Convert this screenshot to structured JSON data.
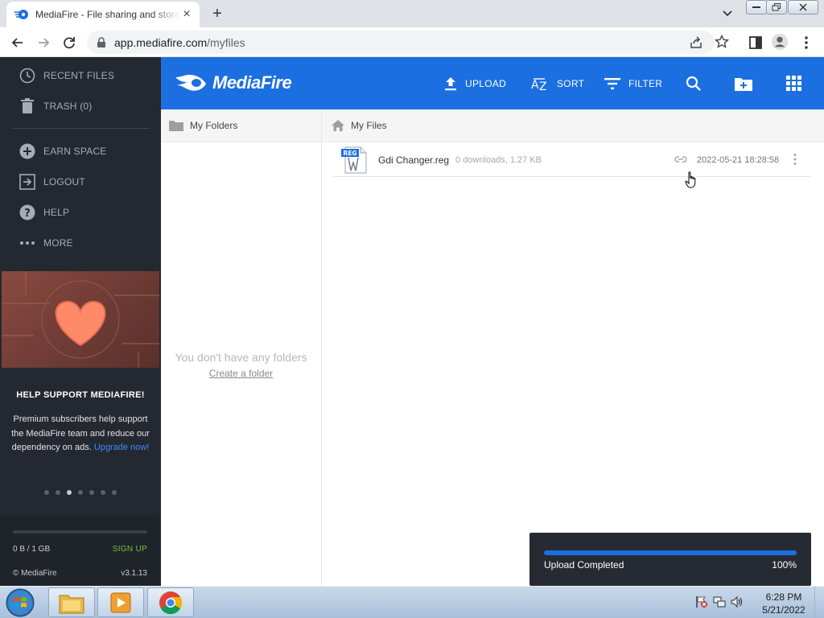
{
  "browser": {
    "tab_title": "MediaFire - File sharing and storage",
    "url_host": "app.mediafire.com",
    "url_path": "/myfiles"
  },
  "sidebar": {
    "items": [
      {
        "label": "RECENT FILES",
        "icon": "clock-icon"
      },
      {
        "label": "TRASH (0)",
        "icon": "trash-icon"
      },
      {
        "label": "EARN SPACE",
        "icon": "plus-circle-icon"
      },
      {
        "label": "LOGOUT",
        "icon": "logout-icon"
      },
      {
        "label": "HELP",
        "icon": "help-icon"
      },
      {
        "label": "MORE",
        "icon": "more-dots-icon"
      }
    ],
    "promo": {
      "title": "HELP SUPPORT MEDIAFIRE!",
      "text": "Premium subscribers help support the MediaFire team and reduce our dependency on ads.",
      "upgrade_link": "Upgrade now!"
    },
    "carousel_dots": 7,
    "carousel_active": 2,
    "storage": {
      "label": "0 B / 1 GB",
      "signup": "SIGN UP",
      "fraction_used": 0
    },
    "copyright": "© MediaFire",
    "version": "v3.1.13"
  },
  "header": {
    "logo": "MediaFire",
    "upload": "UPLOAD",
    "sort": "SORT",
    "filter": "FILTER",
    "accent": "#1b6fe0"
  },
  "folders": {
    "title": "My Folders",
    "empty_text": "You don't have any folders",
    "create_link": "Create a folder"
  },
  "files": {
    "title": "My Files",
    "items": [
      {
        "icon_badge": "REG",
        "name": "Gdi Changer.reg",
        "meta": "0 downloads, 1.27 KB",
        "date": "2022-05-21 18:28:58"
      }
    ]
  },
  "upload_toast": {
    "status": "Upload Completed",
    "percent_text": "100%",
    "progress": 1.0
  },
  "taskbar": {
    "time": "6:28 PM",
    "date": "5/21/2022"
  }
}
